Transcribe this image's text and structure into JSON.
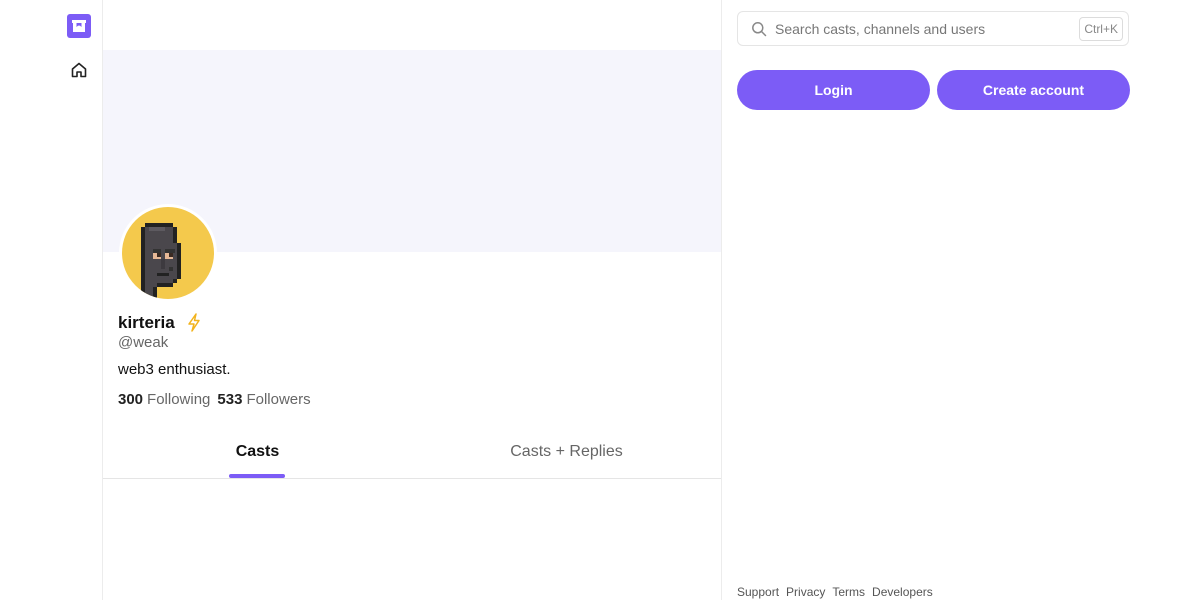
{
  "nav": {
    "logo_icon": "farcaster-arch-logo-icon",
    "home_icon": "home-icon",
    "accent": "#7c5cf6"
  },
  "profile": {
    "display_name": "kirteria",
    "badge_icon": "lightning-bolt-icon",
    "username": "@weak",
    "bio": "web3 enthusiast.",
    "following_count": "300",
    "following_label": "Following",
    "followers_count": "533",
    "followers_label": "Followers",
    "avatar_icon": "pixel-punk-avatar-icon",
    "avatar_bg": "#f4c94c",
    "banner_bg": "#f5f5fc"
  },
  "tabs": [
    {
      "label": "Casts",
      "active": true
    },
    {
      "label": "Casts + Replies",
      "active": false
    }
  ],
  "search": {
    "placeholder": "Search casts, channels and users",
    "shortcut": "Ctrl+K",
    "value": ""
  },
  "auth": {
    "login_label": "Login",
    "create_label": "Create account"
  },
  "footer": {
    "links": [
      "Support",
      "Privacy",
      "Terms",
      "Developers"
    ]
  }
}
